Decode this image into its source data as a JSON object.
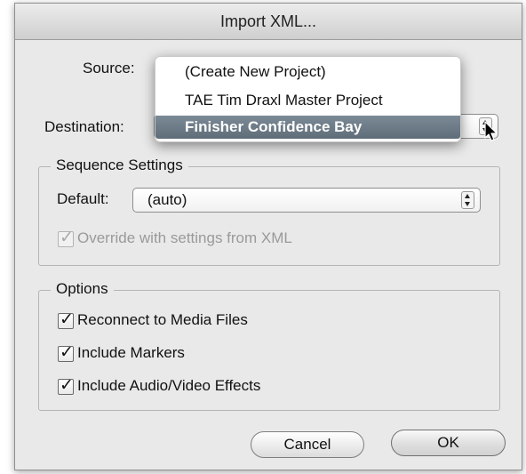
{
  "dialog": {
    "title": "Import XML..."
  },
  "source": {
    "label": "Source:"
  },
  "destination": {
    "label": "Destination:"
  },
  "dropdown_menu": {
    "items": [
      {
        "label": "(Create New Project)",
        "selected": false
      },
      {
        "label": "TAE Tim Draxl Master Project",
        "selected": false
      },
      {
        "label": "Finisher Confidence Bay",
        "selected": true
      }
    ]
  },
  "sequence_settings": {
    "group_title": "Sequence Settings",
    "default_label": "Default:",
    "default_value": "(auto)",
    "override_label": "Override with settings from XML",
    "override_checked": true
  },
  "options": {
    "group_title": "Options",
    "items": [
      {
        "label": "Reconnect to Media Files",
        "checked": true
      },
      {
        "label": "Include Markers",
        "checked": true
      },
      {
        "label": "Include Audio/Video Effects",
        "checked": true
      }
    ]
  },
  "buttons": {
    "cancel": "Cancel",
    "ok": "OK"
  },
  "icons": {
    "checkmark": "checkmark-icon",
    "popup_arrows": "popup-arrows-icon",
    "cursor": "mouse-pointer-icon"
  },
  "colors": {
    "menu_selected": "#6c7a86",
    "dialog_bg": "#e9e9e9"
  }
}
